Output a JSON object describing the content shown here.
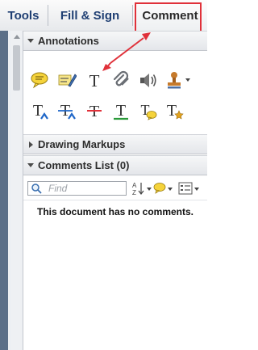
{
  "tabs": [
    {
      "label": "Tools"
    },
    {
      "label": "Fill & Sign"
    },
    {
      "label": "Comment"
    }
  ],
  "panel": {
    "annotations": {
      "title": "Annotations",
      "tools": [
        {
          "name": "sticky-note-icon"
        },
        {
          "name": "highlight-text-icon"
        },
        {
          "name": "add-text-icon"
        },
        {
          "name": "attach-file-icon"
        },
        {
          "name": "record-audio-icon"
        },
        {
          "name": "stamp-icon"
        },
        {
          "name": "insert-text-icon"
        },
        {
          "name": "replace-text-icon"
        },
        {
          "name": "strikethrough-icon"
        },
        {
          "name": "underline-icon"
        },
        {
          "name": "add-note-to-text-icon"
        },
        {
          "name": "text-correction-markup-icon"
        }
      ],
      "add_text_glyph": "T"
    },
    "drawing_markups": {
      "title": "Drawing Markups"
    },
    "comments_list": {
      "title": "Comments List (0)",
      "search_placeholder": "Find",
      "empty_message": "This document has no comments."
    }
  },
  "colors": {
    "accent_red": "#e0313a",
    "tab_text_blue": "#1f3f73",
    "left_strip": "#5b6f88"
  }
}
